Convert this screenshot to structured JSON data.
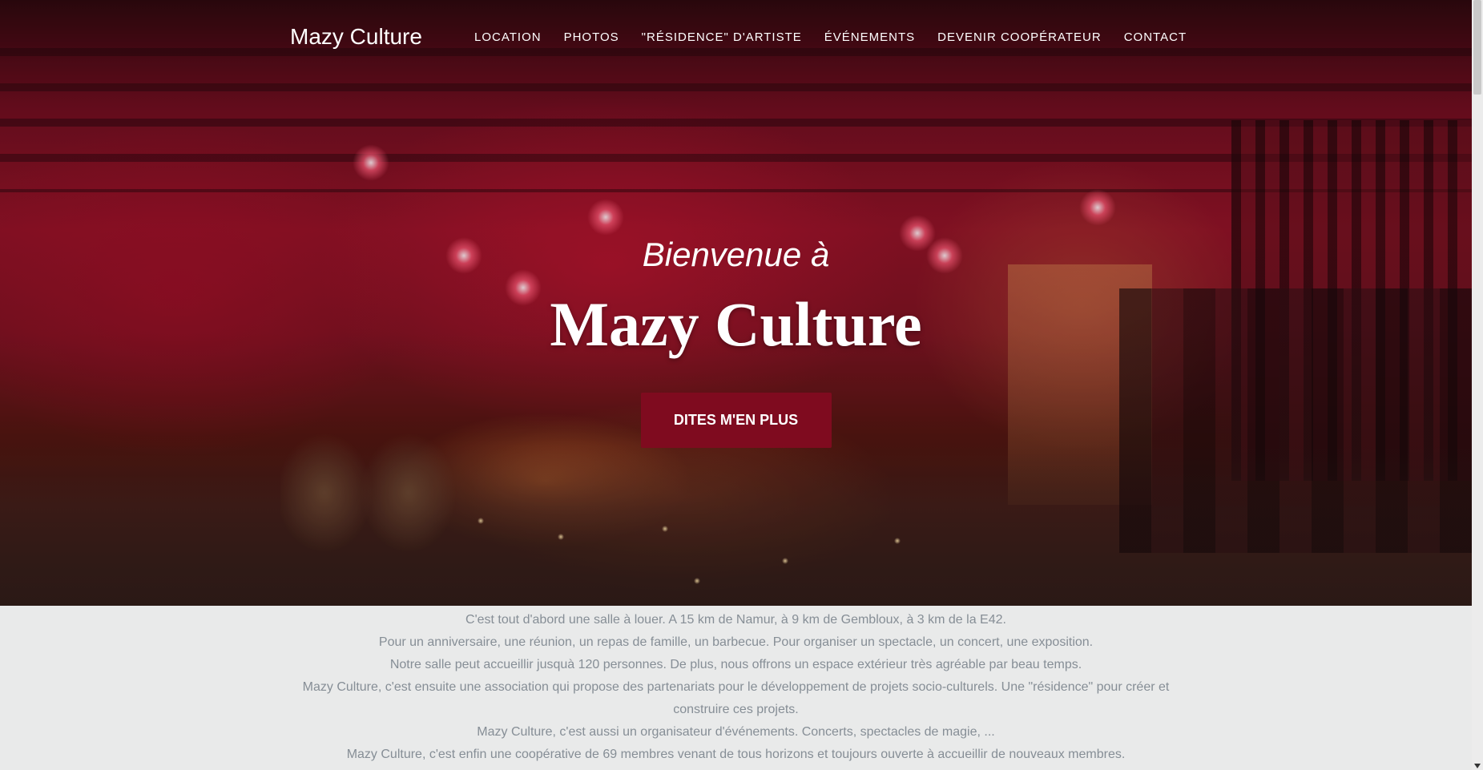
{
  "navbar": {
    "brand": "Mazy Culture",
    "links": [
      {
        "label": "LOCATION"
      },
      {
        "label": "PHOTOS"
      },
      {
        "label": "\"RÉSIDENCE\" D'ARTISTE"
      },
      {
        "label": "ÉVÉNEMENTS"
      },
      {
        "label": "DEVENIR COOPÉRATEUR"
      },
      {
        "label": "CONTACT"
      }
    ]
  },
  "hero": {
    "lead": "Bienvenue à",
    "heading": "Mazy Culture",
    "button_label": "DITES M'EN PLUS"
  },
  "about": {
    "lines": [
      "C'est tout d'abord une salle à louer. A 15 km de Namur, à 9 km de Gembloux, à 3 km de la E42.",
      "Pour un anniversaire, une réunion, un repas de famille, un barbecue. Pour organiser un spectacle, un concert, une exposition.",
      "Notre salle peut accueillir jusquà 120 personnes. De plus, nous offrons un espace extérieur très agréable par beau temps.",
      "Mazy Culture, c'est ensuite une association qui propose des partenariats pour le développement de projets socio-culturels. Une \"résidence\" pour créer et construire ces projets.",
      "Mazy Culture, c'est aussi un organisateur d'événements. Concerts, spectacles de magie, ...",
      "Mazy Culture, c'est enfin une coopérative de 69 membres venant de tous horizons et toujours ouverte à accueillir de nouveaux membres."
    ]
  },
  "colors": {
    "accent": "#7f0b1f",
    "body_text": "#868e96",
    "section_bg": "#e9eaea"
  }
}
